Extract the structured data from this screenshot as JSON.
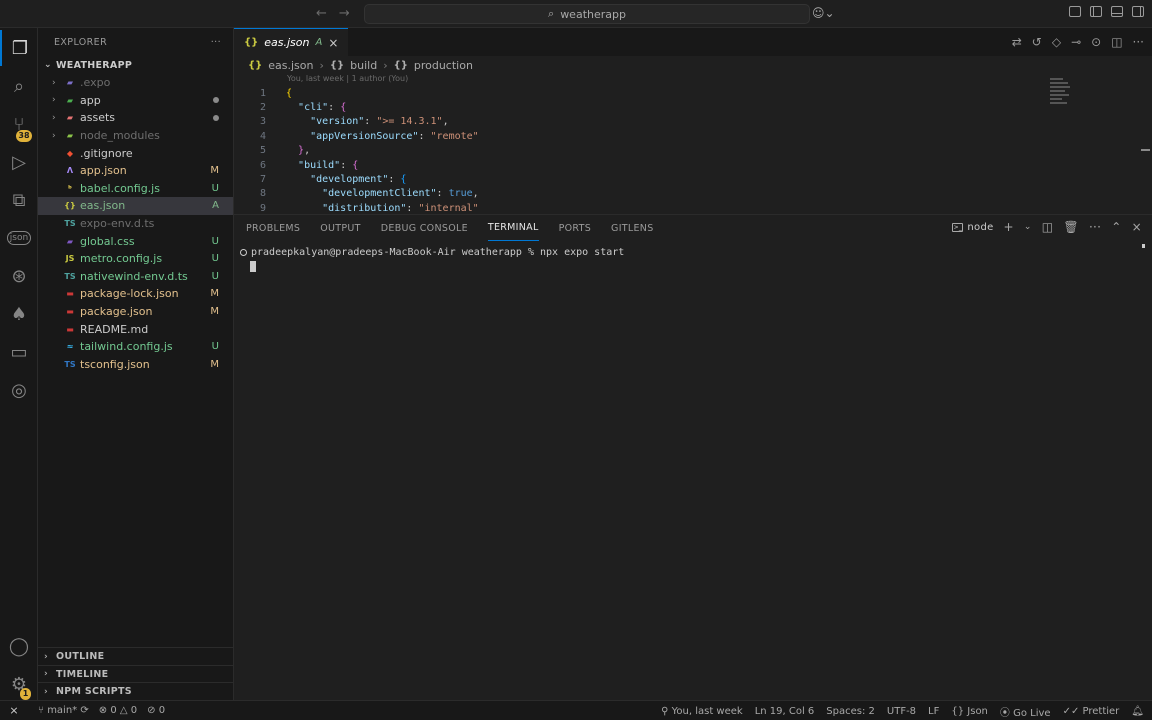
{
  "titlebar": {
    "search_text": "weatherapp"
  },
  "activity_bar": {
    "source_control_badge": "38",
    "settings_badge": "1"
  },
  "explorer": {
    "title": "EXPLORER",
    "more": "···",
    "project": "WEATHERAPP",
    "items": [
      {
        "name": ".expo",
        "kind": "folder",
        "status": "",
        "dim": true,
        "icon": "expo-folder-icon",
        "color": "#7c6fc9"
      },
      {
        "name": "app",
        "kind": "folder",
        "status": "dot",
        "dim": false,
        "icon": "app-folder-icon",
        "color": "#4caf50"
      },
      {
        "name": "assets",
        "kind": "folder",
        "status": "dot",
        "dim": false,
        "icon": "assets-folder-icon",
        "color": "#e57373"
      },
      {
        "name": "node_modules",
        "kind": "folder",
        "status": "",
        "dim": true,
        "icon": "node-modules-folder-icon",
        "color": "#8bc34a"
      },
      {
        "name": ".gitignore",
        "kind": "file",
        "status": "",
        "dim": false,
        "icon": "git-icon",
        "color": "#f05033"
      },
      {
        "name": "app.json",
        "kind": "file",
        "status": "M",
        "dim": false,
        "icon": "expo-icon",
        "color": "#a78bfa"
      },
      {
        "name": "babel.config.js",
        "kind": "file",
        "status": "U",
        "dim": false,
        "icon": "babel-icon",
        "color": "#f5da55"
      },
      {
        "name": "eas.json",
        "kind": "file",
        "status": "A",
        "dim": false,
        "icon": "json-icon",
        "color": "#cbcb41",
        "selected": true
      },
      {
        "name": "expo-env.d.ts",
        "kind": "file",
        "status": "",
        "dim": true,
        "icon": "typescript-def-icon",
        "color": "#4fa3a0"
      },
      {
        "name": "global.css",
        "kind": "file",
        "status": "U",
        "dim": false,
        "icon": "css-icon",
        "color": "#7e57c2"
      },
      {
        "name": "metro.config.js",
        "kind": "file",
        "status": "U",
        "dim": false,
        "icon": "javascript-icon",
        "color": "#cbcb41"
      },
      {
        "name": "nativewind-env.d.ts",
        "kind": "file",
        "status": "U",
        "dim": false,
        "icon": "typescript-def-icon",
        "color": "#4fa3a0"
      },
      {
        "name": "package-lock.json",
        "kind": "file",
        "status": "M",
        "dim": false,
        "icon": "npm-icon",
        "color": "#cb3837"
      },
      {
        "name": "package.json",
        "kind": "file",
        "status": "M",
        "dim": false,
        "icon": "npm-icon",
        "color": "#cb3837"
      },
      {
        "name": "README.md",
        "kind": "file",
        "status": "",
        "dim": false,
        "icon": "readme-icon",
        "color": "#cb3837"
      },
      {
        "name": "tailwind.config.js",
        "kind": "file",
        "status": "U",
        "dim": false,
        "icon": "tailwind-icon",
        "color": "#38bdf8"
      },
      {
        "name": "tsconfig.json",
        "kind": "file",
        "status": "M",
        "dim": false,
        "icon": "tsconfig-icon",
        "color": "#3178c6"
      }
    ],
    "sections": [
      "OUTLINE",
      "TIMELINE",
      "NPM SCRIPTS"
    ]
  },
  "editor": {
    "tab": {
      "label": "eas.json",
      "status": "A",
      "close": "×"
    },
    "breadcrumbs": [
      "eas.json",
      "build",
      "production"
    ],
    "blame_hint": "You, last week | 1 author (You)",
    "lines": [
      {
        "n": "1",
        "indent": "",
        "parts": [
          [
            "brace1",
            "{"
          ]
        ]
      },
      {
        "n": "2",
        "indent": "  ",
        "parts": [
          [
            "key",
            "\"cli\""
          ],
          [
            "punct",
            ": "
          ],
          [
            "brace2",
            "{"
          ]
        ]
      },
      {
        "n": "3",
        "indent": "    ",
        "parts": [
          [
            "key",
            "\"version\""
          ],
          [
            "punct",
            ": "
          ],
          [
            "str",
            "\">= 14.3.1\""
          ],
          [
            "punct",
            ","
          ]
        ]
      },
      {
        "n": "4",
        "indent": "    ",
        "parts": [
          [
            "key",
            "\"appVersionSource\""
          ],
          [
            "punct",
            ": "
          ],
          [
            "str",
            "\"remote\""
          ]
        ]
      },
      {
        "n": "5",
        "indent": "  ",
        "parts": [
          [
            "brace2",
            "}"
          ],
          [
            "punct",
            ","
          ]
        ]
      },
      {
        "n": "6",
        "indent": "  ",
        "parts": [
          [
            "key",
            "\"build\""
          ],
          [
            "punct",
            ": "
          ],
          [
            "brace2",
            "{"
          ]
        ]
      },
      {
        "n": "7",
        "indent": "    ",
        "parts": [
          [
            "key",
            "\"development\""
          ],
          [
            "punct",
            ": "
          ],
          [
            "brace3",
            "{"
          ]
        ]
      },
      {
        "n": "8",
        "indent": "      ",
        "parts": [
          [
            "key",
            "\"developmentClient\""
          ],
          [
            "punct",
            ": "
          ],
          [
            "bool",
            "true"
          ],
          [
            "punct",
            ","
          ]
        ]
      },
      {
        "n": "9",
        "indent": "      ",
        "parts": [
          [
            "key",
            "\"distribution\""
          ],
          [
            "punct",
            ": "
          ],
          [
            "str",
            "\"internal\""
          ]
        ]
      }
    ]
  },
  "panel": {
    "tabs": [
      "PROBLEMS",
      "OUTPUT",
      "DEBUG CONSOLE",
      "TERMINAL",
      "PORTS",
      "GITLENS"
    ],
    "active_tab": "TERMINAL",
    "terminal_name": "node",
    "terminal_line": "pradeepkalyan@pradeeps-MacBook-Air weatherapp % npx expo start"
  },
  "statusbar": {
    "branch": "main*",
    "errors": "0",
    "warnings": "0",
    "ports": "0",
    "blame": "You, last week",
    "position": "Ln 19, Col 6",
    "spaces": "Spaces: 2",
    "encoding": "UTF-8",
    "eol": "LF",
    "language": "Json",
    "golive": "Go Live",
    "prettier": "Prettier"
  }
}
